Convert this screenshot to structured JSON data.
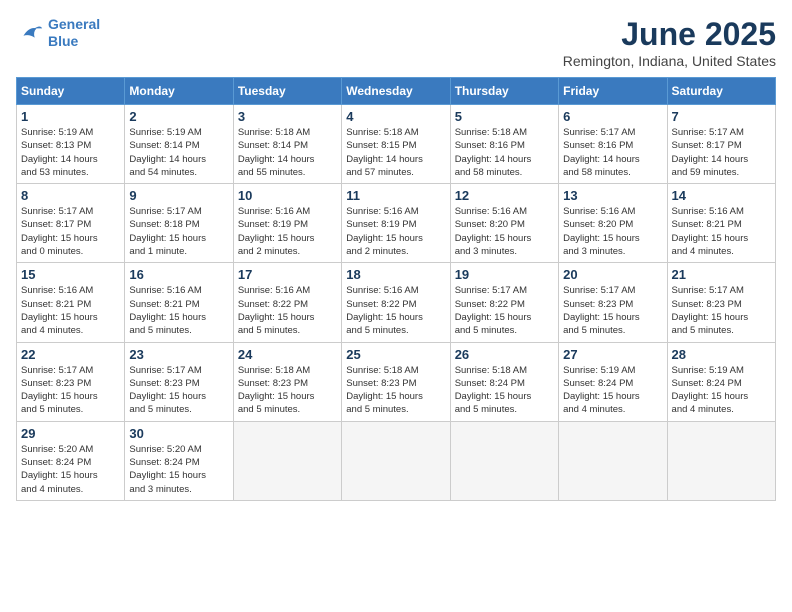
{
  "header": {
    "logo_line1": "General",
    "logo_line2": "Blue",
    "month": "June 2025",
    "location": "Remington, Indiana, United States"
  },
  "weekdays": [
    "Sunday",
    "Monday",
    "Tuesday",
    "Wednesday",
    "Thursday",
    "Friday",
    "Saturday"
  ],
  "weeks": [
    [
      {
        "day": "1",
        "sunrise": "5:19 AM",
        "sunset": "8:13 PM",
        "daylight": "14 hours and 53 minutes."
      },
      {
        "day": "2",
        "sunrise": "5:19 AM",
        "sunset": "8:14 PM",
        "daylight": "14 hours and 54 minutes."
      },
      {
        "day": "3",
        "sunrise": "5:18 AM",
        "sunset": "8:14 PM",
        "daylight": "14 hours and 55 minutes."
      },
      {
        "day": "4",
        "sunrise": "5:18 AM",
        "sunset": "8:15 PM",
        "daylight": "14 hours and 57 minutes."
      },
      {
        "day": "5",
        "sunrise": "5:18 AM",
        "sunset": "8:16 PM",
        "daylight": "14 hours and 58 minutes."
      },
      {
        "day": "6",
        "sunrise": "5:17 AM",
        "sunset": "8:16 PM",
        "daylight": "14 hours and 58 minutes."
      },
      {
        "day": "7",
        "sunrise": "5:17 AM",
        "sunset": "8:17 PM",
        "daylight": "14 hours and 59 minutes."
      }
    ],
    [
      {
        "day": "8",
        "sunrise": "5:17 AM",
        "sunset": "8:17 PM",
        "daylight": "15 hours and 0 minutes."
      },
      {
        "day": "9",
        "sunrise": "5:17 AM",
        "sunset": "8:18 PM",
        "daylight": "15 hours and 1 minute."
      },
      {
        "day": "10",
        "sunrise": "5:16 AM",
        "sunset": "8:19 PM",
        "daylight": "15 hours and 2 minutes."
      },
      {
        "day": "11",
        "sunrise": "5:16 AM",
        "sunset": "8:19 PM",
        "daylight": "15 hours and 2 minutes."
      },
      {
        "day": "12",
        "sunrise": "5:16 AM",
        "sunset": "8:20 PM",
        "daylight": "15 hours and 3 minutes."
      },
      {
        "day": "13",
        "sunrise": "5:16 AM",
        "sunset": "8:20 PM",
        "daylight": "15 hours and 3 minutes."
      },
      {
        "day": "14",
        "sunrise": "5:16 AM",
        "sunset": "8:21 PM",
        "daylight": "15 hours and 4 minutes."
      }
    ],
    [
      {
        "day": "15",
        "sunrise": "5:16 AM",
        "sunset": "8:21 PM",
        "daylight": "15 hours and 4 minutes."
      },
      {
        "day": "16",
        "sunrise": "5:16 AM",
        "sunset": "8:21 PM",
        "daylight": "15 hours and 5 minutes."
      },
      {
        "day": "17",
        "sunrise": "5:16 AM",
        "sunset": "8:22 PM",
        "daylight": "15 hours and 5 minutes."
      },
      {
        "day": "18",
        "sunrise": "5:16 AM",
        "sunset": "8:22 PM",
        "daylight": "15 hours and 5 minutes."
      },
      {
        "day": "19",
        "sunrise": "5:17 AM",
        "sunset": "8:22 PM",
        "daylight": "15 hours and 5 minutes."
      },
      {
        "day": "20",
        "sunrise": "5:17 AM",
        "sunset": "8:23 PM",
        "daylight": "15 hours and 5 minutes."
      },
      {
        "day": "21",
        "sunrise": "5:17 AM",
        "sunset": "8:23 PM",
        "daylight": "15 hours and 5 minutes."
      }
    ],
    [
      {
        "day": "22",
        "sunrise": "5:17 AM",
        "sunset": "8:23 PM",
        "daylight": "15 hours and 5 minutes."
      },
      {
        "day": "23",
        "sunrise": "5:17 AM",
        "sunset": "8:23 PM",
        "daylight": "15 hours and 5 minutes."
      },
      {
        "day": "24",
        "sunrise": "5:18 AM",
        "sunset": "8:23 PM",
        "daylight": "15 hours and 5 minutes."
      },
      {
        "day": "25",
        "sunrise": "5:18 AM",
        "sunset": "8:23 PM",
        "daylight": "15 hours and 5 minutes."
      },
      {
        "day": "26",
        "sunrise": "5:18 AM",
        "sunset": "8:24 PM",
        "daylight": "15 hours and 5 minutes."
      },
      {
        "day": "27",
        "sunrise": "5:19 AM",
        "sunset": "8:24 PM",
        "daylight": "15 hours and 4 minutes."
      },
      {
        "day": "28",
        "sunrise": "5:19 AM",
        "sunset": "8:24 PM",
        "daylight": "15 hours and 4 minutes."
      }
    ],
    [
      {
        "day": "29",
        "sunrise": "5:20 AM",
        "sunset": "8:24 PM",
        "daylight": "15 hours and 4 minutes."
      },
      {
        "day": "30",
        "sunrise": "5:20 AM",
        "sunset": "8:24 PM",
        "daylight": "15 hours and 3 minutes."
      },
      null,
      null,
      null,
      null,
      null
    ]
  ]
}
